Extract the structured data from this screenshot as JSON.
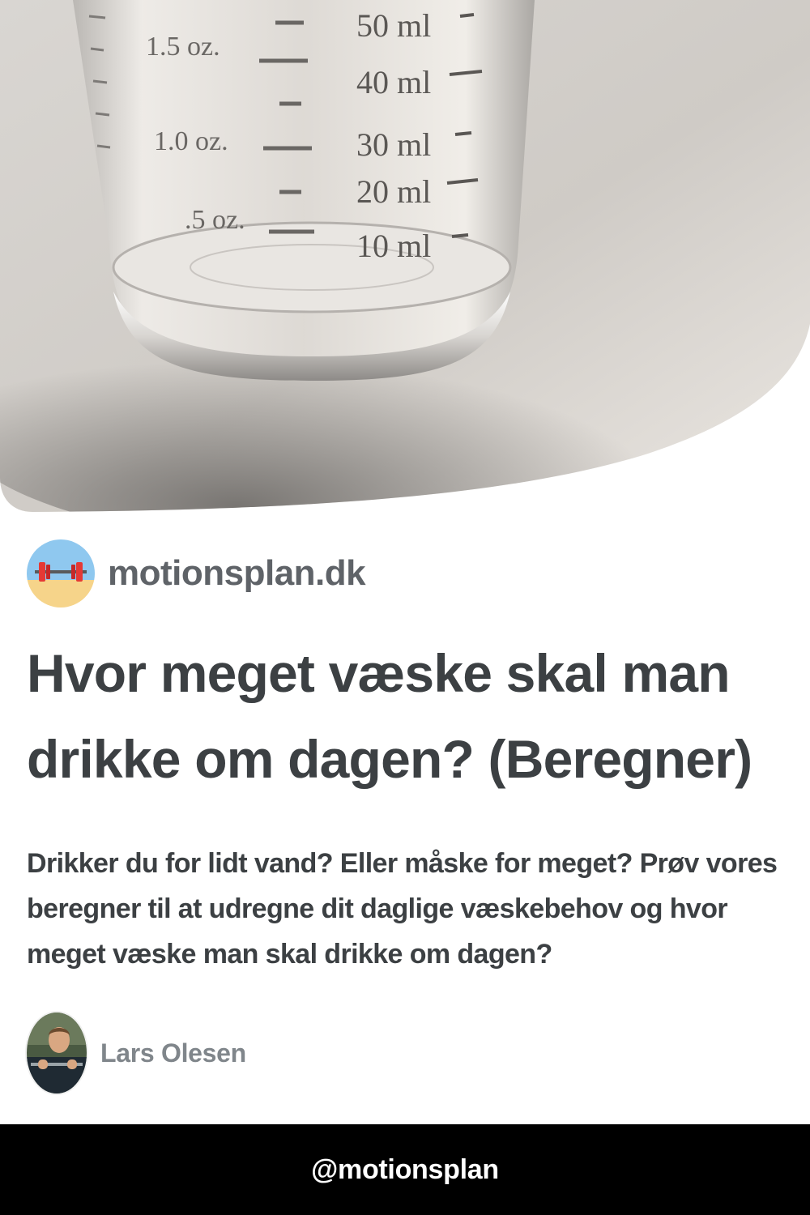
{
  "hero": {
    "glass_markings": [
      "50 ml",
      "40 ml",
      "30 ml",
      "20 ml",
      "10 ml",
      "1.5 oz.",
      "1.0 oz.",
      ".5 oz."
    ]
  },
  "site": {
    "name": "motionsplan.dk",
    "logo_icon": "barbell-beach-icon"
  },
  "article": {
    "title": "Hvor meget væske skal man drikke om dagen? (Beregner)",
    "description": "Drikker du for lidt vand? Eller måske for meget? Prøv vores beregner til at udregne dit daglige væskebehov og hvor meget væske man skal drikke om dagen?"
  },
  "author": {
    "name": "Lars Olesen"
  },
  "footer": {
    "handle": "@motionsplan"
  }
}
